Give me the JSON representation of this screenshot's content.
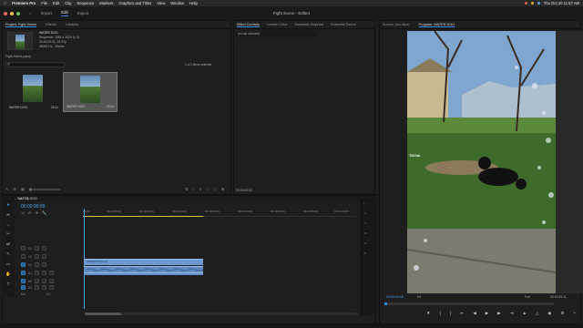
{
  "menubar": {
    "app": "Premiere Pro",
    "items": [
      "File",
      "Edit",
      "Clip",
      "Sequence",
      "Markers",
      "Graphics and Titles",
      "View",
      "Window",
      "Help"
    ],
    "clock": "Thu Oct 20  11:57 AM"
  },
  "header": {
    "nav": [
      "Import",
      "Edit",
      "Export"
    ],
    "active_nav": "Edit",
    "doc_title": "Fight Scene - Edited"
  },
  "project": {
    "tabs": [
      "Project: Fight Scene",
      "Effects",
      "Libraries"
    ],
    "clip_name": "WATER DOG",
    "meta_line1": "Sequence, 1080 x 1920 (1.0)",
    "meta_line2": "00:00:29:11, 29.97p",
    "meta_line3": "48000 Hz - Stereo",
    "project_file": "Fight Scene.prproj",
    "items_selected": "1 of 2 items selected",
    "clips": [
      {
        "name": "WATER DOG",
        "duration": "29:11"
      },
      {
        "name": "WATER DOG",
        "duration": "29:11"
      }
    ]
  },
  "effects": {
    "tabs": [
      "Effect Controls",
      "Lumetri Color",
      "Essential Graphics",
      "Essential Sound"
    ],
    "no_clip": "(no clip selected)",
    "timecode": "00:00:00:00"
  },
  "program": {
    "tabs": [
      "Source: (no clips)",
      "Program: WATER DOG"
    ],
    "watermark": "TikTok",
    "current_time": "00:00:00:00",
    "fit": "Fit",
    "quality": "Full",
    "duration": "00:00:29:11"
  },
  "timeline": {
    "tab": "WATER DOG",
    "timecode": "00:00:00:00",
    "ruler": [
      "00:00",
      "00:00:08:00",
      "00:00:16:00",
      "00:00:24:00",
      "00:00:32:00",
      "00:00:40:00",
      "00:00:48:00",
      "00:00:56:00",
      "00:01:04:00"
    ],
    "tracks": [
      "V3",
      "V2",
      "V1",
      "A1",
      "A2",
      "A3",
      "Mix"
    ],
    "mix_value": "0.0",
    "video_clip": "WATER DOG [V]"
  },
  "colors": {
    "accent": "#2d8ceb",
    "clip": "#6c9ad0"
  }
}
